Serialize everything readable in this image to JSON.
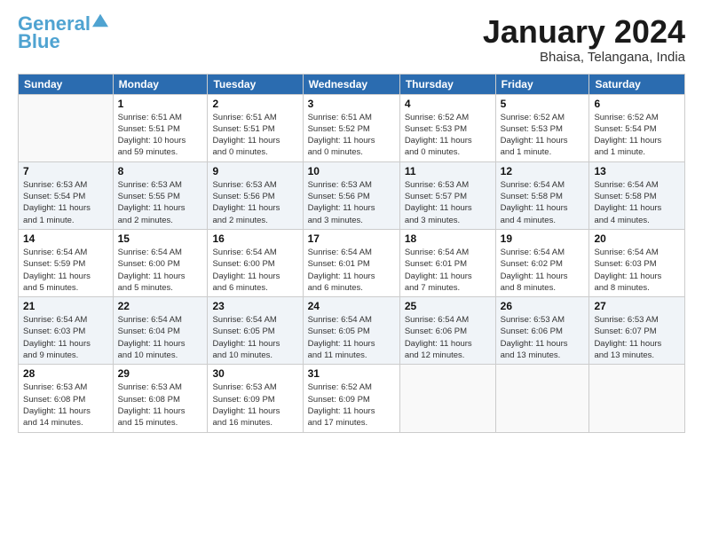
{
  "logo": {
    "line1": "General",
    "line2": "Blue"
  },
  "title": "January 2024",
  "subtitle": "Bhaisa, Telangana, India",
  "days_of_week": [
    "Sunday",
    "Monday",
    "Tuesday",
    "Wednesday",
    "Thursday",
    "Friday",
    "Saturday"
  ],
  "weeks": [
    [
      {
        "day": "",
        "info": ""
      },
      {
        "day": "1",
        "info": "Sunrise: 6:51 AM\nSunset: 5:51 PM\nDaylight: 10 hours\nand 59 minutes."
      },
      {
        "day": "2",
        "info": "Sunrise: 6:51 AM\nSunset: 5:51 PM\nDaylight: 11 hours\nand 0 minutes."
      },
      {
        "day": "3",
        "info": "Sunrise: 6:51 AM\nSunset: 5:52 PM\nDaylight: 11 hours\nand 0 minutes."
      },
      {
        "day": "4",
        "info": "Sunrise: 6:52 AM\nSunset: 5:53 PM\nDaylight: 11 hours\nand 0 minutes."
      },
      {
        "day": "5",
        "info": "Sunrise: 6:52 AM\nSunset: 5:53 PM\nDaylight: 11 hours\nand 1 minute."
      },
      {
        "day": "6",
        "info": "Sunrise: 6:52 AM\nSunset: 5:54 PM\nDaylight: 11 hours\nand 1 minute."
      }
    ],
    [
      {
        "day": "7",
        "info": "Sunrise: 6:53 AM\nSunset: 5:54 PM\nDaylight: 11 hours\nand 1 minute."
      },
      {
        "day": "8",
        "info": "Sunrise: 6:53 AM\nSunset: 5:55 PM\nDaylight: 11 hours\nand 2 minutes."
      },
      {
        "day": "9",
        "info": "Sunrise: 6:53 AM\nSunset: 5:56 PM\nDaylight: 11 hours\nand 2 minutes."
      },
      {
        "day": "10",
        "info": "Sunrise: 6:53 AM\nSunset: 5:56 PM\nDaylight: 11 hours\nand 3 minutes."
      },
      {
        "day": "11",
        "info": "Sunrise: 6:53 AM\nSunset: 5:57 PM\nDaylight: 11 hours\nand 3 minutes."
      },
      {
        "day": "12",
        "info": "Sunrise: 6:54 AM\nSunset: 5:58 PM\nDaylight: 11 hours\nand 4 minutes."
      },
      {
        "day": "13",
        "info": "Sunrise: 6:54 AM\nSunset: 5:58 PM\nDaylight: 11 hours\nand 4 minutes."
      }
    ],
    [
      {
        "day": "14",
        "info": "Sunrise: 6:54 AM\nSunset: 5:59 PM\nDaylight: 11 hours\nand 5 minutes."
      },
      {
        "day": "15",
        "info": "Sunrise: 6:54 AM\nSunset: 6:00 PM\nDaylight: 11 hours\nand 5 minutes."
      },
      {
        "day": "16",
        "info": "Sunrise: 6:54 AM\nSunset: 6:00 PM\nDaylight: 11 hours\nand 6 minutes."
      },
      {
        "day": "17",
        "info": "Sunrise: 6:54 AM\nSunset: 6:01 PM\nDaylight: 11 hours\nand 6 minutes."
      },
      {
        "day": "18",
        "info": "Sunrise: 6:54 AM\nSunset: 6:01 PM\nDaylight: 11 hours\nand 7 minutes."
      },
      {
        "day": "19",
        "info": "Sunrise: 6:54 AM\nSunset: 6:02 PM\nDaylight: 11 hours\nand 8 minutes."
      },
      {
        "day": "20",
        "info": "Sunrise: 6:54 AM\nSunset: 6:03 PM\nDaylight: 11 hours\nand 8 minutes."
      }
    ],
    [
      {
        "day": "21",
        "info": "Sunrise: 6:54 AM\nSunset: 6:03 PM\nDaylight: 11 hours\nand 9 minutes."
      },
      {
        "day": "22",
        "info": "Sunrise: 6:54 AM\nSunset: 6:04 PM\nDaylight: 11 hours\nand 10 minutes."
      },
      {
        "day": "23",
        "info": "Sunrise: 6:54 AM\nSunset: 6:05 PM\nDaylight: 11 hours\nand 10 minutes."
      },
      {
        "day": "24",
        "info": "Sunrise: 6:54 AM\nSunset: 6:05 PM\nDaylight: 11 hours\nand 11 minutes."
      },
      {
        "day": "25",
        "info": "Sunrise: 6:54 AM\nSunset: 6:06 PM\nDaylight: 11 hours\nand 12 minutes."
      },
      {
        "day": "26",
        "info": "Sunrise: 6:53 AM\nSunset: 6:06 PM\nDaylight: 11 hours\nand 13 minutes."
      },
      {
        "day": "27",
        "info": "Sunrise: 6:53 AM\nSunset: 6:07 PM\nDaylight: 11 hours\nand 13 minutes."
      }
    ],
    [
      {
        "day": "28",
        "info": "Sunrise: 6:53 AM\nSunset: 6:08 PM\nDaylight: 11 hours\nand 14 minutes."
      },
      {
        "day": "29",
        "info": "Sunrise: 6:53 AM\nSunset: 6:08 PM\nDaylight: 11 hours\nand 15 minutes."
      },
      {
        "day": "30",
        "info": "Sunrise: 6:53 AM\nSunset: 6:09 PM\nDaylight: 11 hours\nand 16 minutes."
      },
      {
        "day": "31",
        "info": "Sunrise: 6:52 AM\nSunset: 6:09 PM\nDaylight: 11 hours\nand 17 minutes."
      },
      {
        "day": "",
        "info": ""
      },
      {
        "day": "",
        "info": ""
      },
      {
        "day": "",
        "info": ""
      }
    ]
  ]
}
